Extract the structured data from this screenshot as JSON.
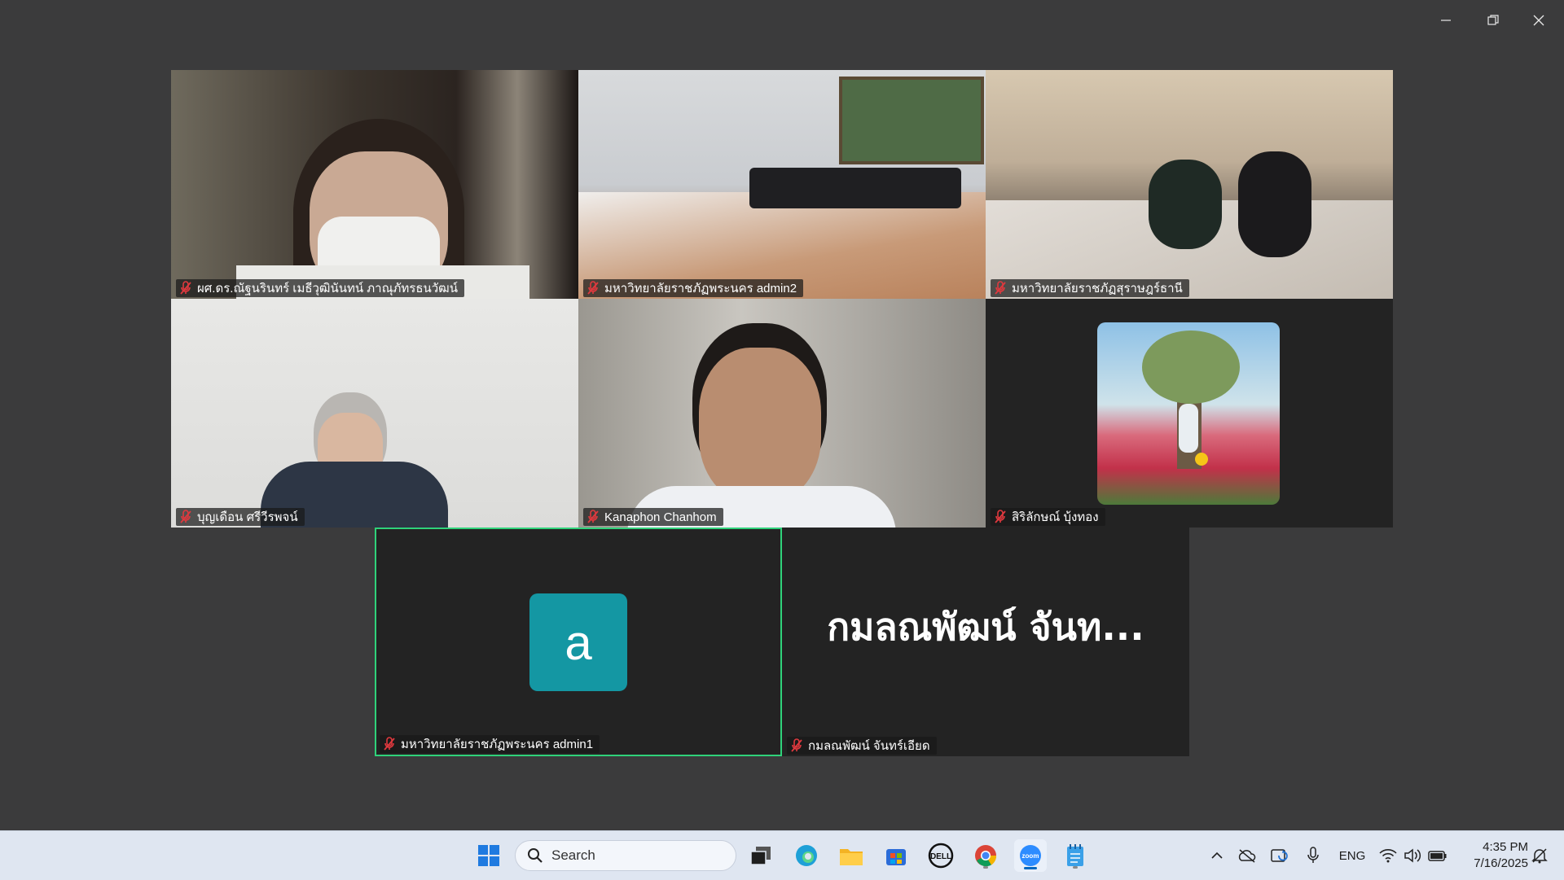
{
  "window": {
    "controls": [
      "minimize",
      "restore",
      "close"
    ]
  },
  "participants": [
    {
      "name": "ผศ.ดร.ณัฐนรินทร์ เมธีวุฒินันทน์ ภาณุภัทรธนวัฒน์",
      "muted": true,
      "view": "video"
    },
    {
      "name": "มหาวิทยาลัยราชภัฏพระนคร admin2",
      "muted": true,
      "view": "video"
    },
    {
      "name": "มหาวิทยาลัยราชภัฏสุราษฎร์ธานี",
      "muted": true,
      "view": "video"
    },
    {
      "name": "บุญเดือน ศรีวีรพจน์",
      "muted": true,
      "view": "video"
    },
    {
      "name": "Kanaphon Chanhom",
      "muted": true,
      "view": "video"
    },
    {
      "name": "สิริลักษณ์ บุ้งทอง",
      "muted": true,
      "view": "profile-photo"
    },
    {
      "name": "มหาวิทยาลัยราชภัฏพระนคร admin1",
      "muted": true,
      "view": "avatar",
      "avatar_letter": "a",
      "avatar_color": "#1497a3",
      "active_speaker": true
    },
    {
      "name": "กมลณพัฒน์ จันทร์เอียด",
      "muted": true,
      "view": "name-only",
      "display_name": "กมลณพัฒน์ จันท..."
    }
  ],
  "colors": {
    "active_speaker_border": "#2fd27a",
    "mute_icon": "#e0393e",
    "tile_bg": "#232323",
    "app_bg": "#3b3b3c"
  },
  "taskbar": {
    "search_label": "Search",
    "pinned": [
      "windows-start-icon",
      "search",
      "task-view-icon",
      "edge-icon",
      "file-explorer-icon",
      "microsoft-store-icon",
      "dell-icon",
      "chrome-icon",
      "zoom-icon",
      "notepad-icon"
    ],
    "tray": [
      "chevron-up-icon",
      "onedrive-icon",
      "sync-icon",
      "microphone-icon",
      "ENG",
      "wifi-icon",
      "volume-icon",
      "battery-icon",
      "notification-icon"
    ],
    "language": "ENG",
    "time": "4:35 PM",
    "date": "7/16/2025"
  }
}
